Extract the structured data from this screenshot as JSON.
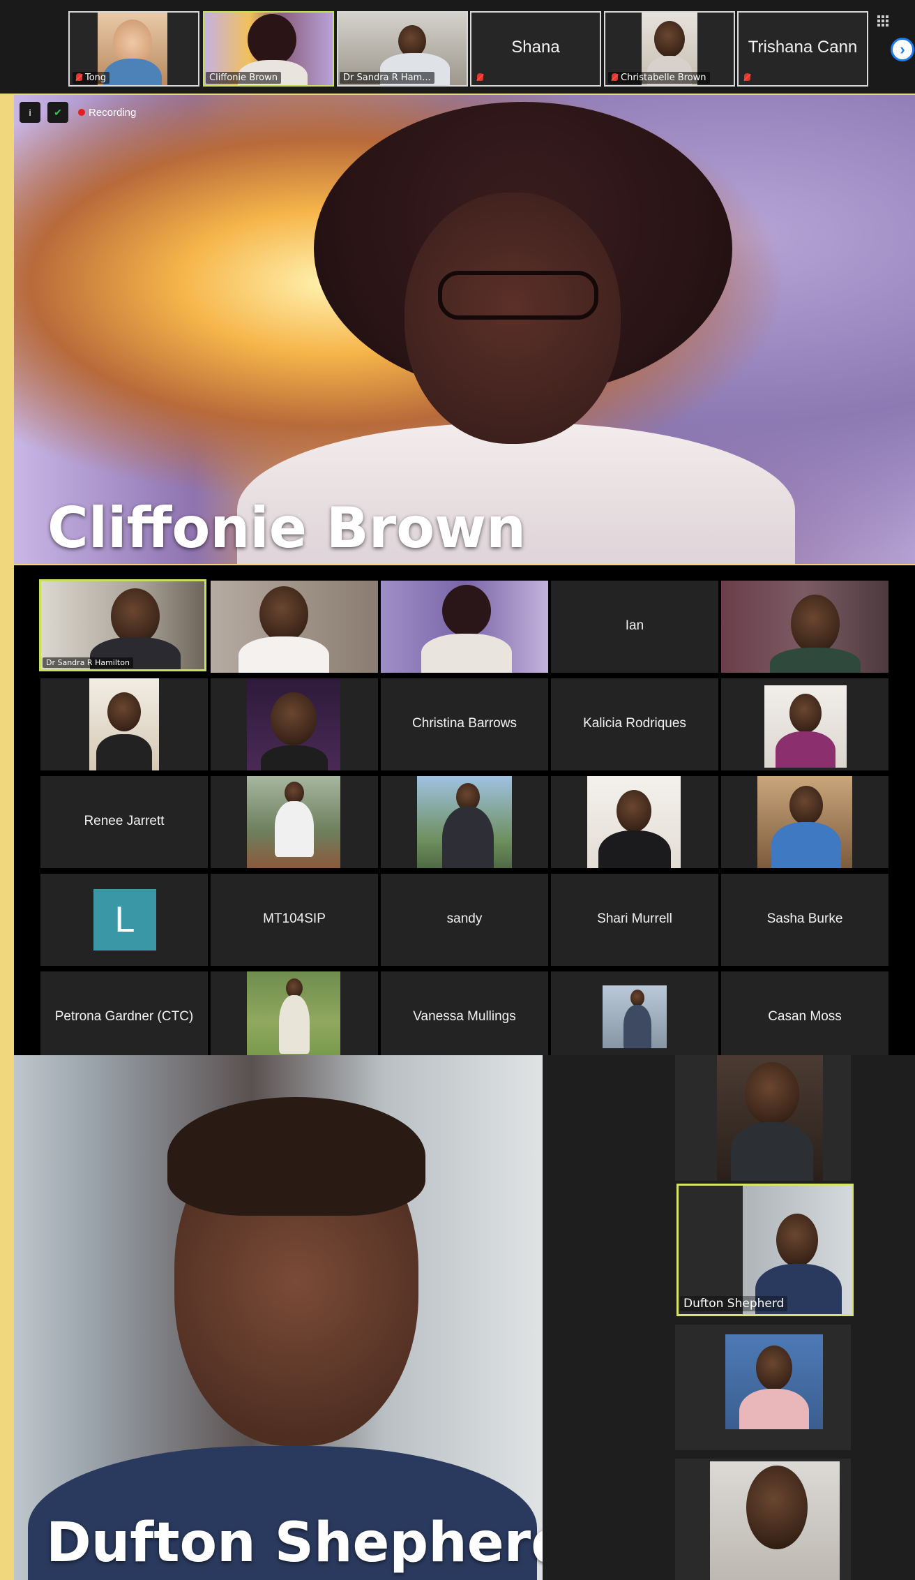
{
  "top_strip": {
    "tiles": [
      {
        "name": "Tong",
        "type": "video",
        "muted": true
      },
      {
        "name": "Cliffonie Brown",
        "type": "video",
        "muted": false
      },
      {
        "name": "Dr Sandra R Ham...",
        "type": "video",
        "muted": false
      },
      {
        "name": "Shana",
        "type": "name_only",
        "muted": true
      },
      {
        "name": "Christabelle Brown",
        "type": "video",
        "muted": true
      },
      {
        "name": "Trishana Cann",
        "type": "name_only",
        "muted": true
      }
    ]
  },
  "recording": {
    "label": "Recording",
    "info_icon": "i"
  },
  "speaker_top": {
    "name": "Cliffonie Brown"
  },
  "gallery": {
    "rows": [
      [
        {
          "name": "Dr Sandra R Hamilton",
          "type": "video",
          "active": true
        },
        {
          "name": "",
          "type": "video"
        },
        {
          "name": "",
          "type": "video"
        },
        {
          "name": "Ian",
          "type": "name_only"
        },
        {
          "name": "",
          "type": "video"
        }
      ],
      [
        {
          "name": "",
          "type": "photo"
        },
        {
          "name": "",
          "type": "photo"
        },
        {
          "name": "Christina Barrows",
          "type": "name_only"
        },
        {
          "name": "Kalicia Rodriques",
          "type": "name_only"
        },
        {
          "name": "",
          "type": "photo"
        }
      ],
      [
        {
          "name": "Renee Jarrett",
          "type": "name_only"
        },
        {
          "name": "",
          "type": "photo"
        },
        {
          "name": "",
          "type": "photo"
        },
        {
          "name": "",
          "type": "photo"
        },
        {
          "name": "",
          "type": "photo"
        }
      ],
      [
        {
          "name": "",
          "type": "avatar",
          "avatar_letter": "L"
        },
        {
          "name": "MT104SIP",
          "type": "name_only"
        },
        {
          "name": "sandy",
          "type": "name_only"
        },
        {
          "name": "Shari Murrell",
          "type": "name_only"
        },
        {
          "name": "Sasha Burke",
          "type": "name_only"
        }
      ],
      [
        {
          "name": "Petrona Gardner (CTC)",
          "type": "name_only"
        },
        {
          "name": "",
          "type": "photo"
        },
        {
          "name": "Vanessa Mullings",
          "type": "name_only"
        },
        {
          "name": "",
          "type": "photo"
        },
        {
          "name": "Casan Moss",
          "type": "name_only"
        }
      ]
    ]
  },
  "speaker_bottom": {
    "name": "Dufton  Shepherd"
  },
  "right_strip": {
    "tiles": [
      {
        "name": "",
        "type": "video"
      },
      {
        "name": "Dufton Shepherd",
        "type": "video",
        "active": true
      },
      {
        "name": "",
        "type": "photo"
      },
      {
        "name": "",
        "type": "video"
      }
    ]
  },
  "colors": {
    "frame": "#f0d77e",
    "active_border": "#c7e25a",
    "tile_bg": "#232323",
    "avatar_bg": "#3a97a6",
    "muted_red": "#e0362c",
    "nav_blue": "#1a7cf0"
  },
  "icons": {
    "next_page": "chevron-right-icon",
    "view": "grid-view-icon",
    "info": "info-icon",
    "security": "shield-icon",
    "mic": "mic-off-icon"
  }
}
